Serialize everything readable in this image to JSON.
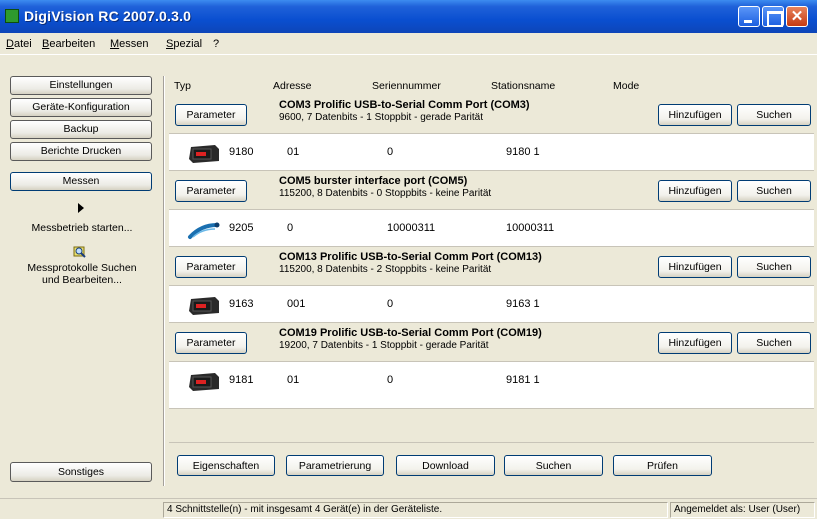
{
  "window": {
    "title": "DigiVision RC 2007.0.3.0"
  },
  "menu": [
    "Datei",
    "Bearbeiten",
    "Messen",
    "Spezial",
    "?"
  ],
  "sidebar": {
    "buttons": [
      "Einstellungen",
      "Geräte-Konfiguration",
      "Backup",
      "Berichte Drucken",
      "Messen"
    ],
    "start_label": "Messbetrieb starten...",
    "search_label_1": "Messprotokolle Suchen",
    "search_label_2": "und Bearbeiten...",
    "other_button": "Sonstiges"
  },
  "columns": [
    "Typ",
    "Adresse",
    "Seriennummer",
    "Stationsname",
    "Mode"
  ],
  "row_buttons": {
    "parameter": "Parameter",
    "add": "Hinzufügen",
    "search": "Suchen"
  },
  "interfaces": [
    {
      "title": "COM3 Prolific USB-to-Serial Comm Port (COM3)",
      "settings": "9600, 7 Datenbits - 1 Stoppbit - gerade Parität",
      "device": {
        "icon": "meter-device-icon",
        "type": "9180",
        "address": "01",
        "serial": "0",
        "station": "9180 1"
      }
    },
    {
      "title": "COM5 burster interface port (COM5)",
      "settings": "115200, 8 Datenbits - 0 Stoppbits - keine Parität",
      "device": {
        "icon": "probe-device-icon",
        "type": "9205",
        "address": "0",
        "serial": "10000311",
        "station": "10000311"
      }
    },
    {
      "title": "COM13 Prolific USB-to-Serial Comm Port (COM13)",
      "settings": "115200, 8 Datenbits - 2 Stoppbits - keine Parität",
      "device": {
        "icon": "meter-device-icon",
        "type": "9163",
        "address": "001",
        "serial": "0",
        "station": "9163 1"
      }
    },
    {
      "title": "COM19 Prolific USB-to-Serial Comm Port (COM19)",
      "settings": "19200, 7 Datenbits - 1 Stoppbit - gerade Parität",
      "device": {
        "icon": "meter-device-icon",
        "type": "9181",
        "address": "01",
        "serial": "0",
        "station": "9181 1"
      }
    }
  ],
  "bottom_buttons": [
    "Eigenschaften",
    "Parametrierung",
    "Download",
    "Suchen",
    "Prüfen"
  ],
  "status": {
    "left": "4 Schnittstelle(n) - mit insgesamt 4 Gerät(e) in der Geräteliste.",
    "right": "Angemeldet als: User (User)"
  }
}
